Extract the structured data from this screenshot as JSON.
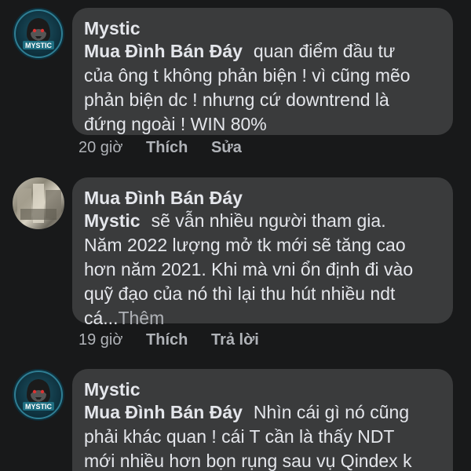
{
  "comments": [
    {
      "author": "Mystic",
      "tag": "Mua Đình Bán Đáy",
      "lines": [
        "quan điểm đầu tư",
        "của ông t không phản biện ! vì cũng mẽo",
        "phản biện dc ! nhưng cứ downtrend là",
        "đứng ngoài ! WIN 80%"
      ],
      "time": "20 giờ",
      "like": "Thích",
      "action2": "Sửa",
      "avatar_text": "MYSTIC"
    },
    {
      "author": "Mua Đình Bán Đáy",
      "tag": "Mystic",
      "lines": [
        "sẽ vẫn nhiều người tham gia.",
        "Năm 2022 lượng mở tk mới sẽ tăng cao",
        "hơn năm 2021. Khi mà vni ổn định đi vào",
        "quỹ đạo của nó thì lại thu hút nhiều ndt",
        "cá..."
      ],
      "more": "Thêm",
      "time": "19 giờ",
      "like": "Thích",
      "action2": "Trả lời"
    },
    {
      "author": "Mystic",
      "tag": "Mua Đình Bán Đáy",
      "lines": [
        "Nhìn cái gì nó cũng",
        "phải khác quan ! cái T cần là thấy NDT",
        "mới nhiều hơn bọn rụng sau vụ Qindex k"
      ],
      "avatar_text": "MYSTIC"
    }
  ],
  "colors": {
    "background": "#18191a",
    "bubble": "#3a3b3c",
    "text": "#e4e6eb",
    "meta": "#b0b3b8"
  }
}
